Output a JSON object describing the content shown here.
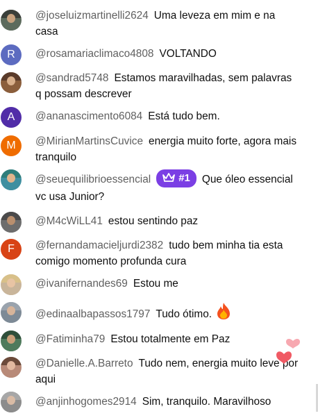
{
  "chat": {
    "messages": [
      {
        "author": "@joseluizmartinelli2624",
        "text": "Uma leveza em mim e na casa",
        "avatar": {
          "kind": "photo",
          "hair": "#3a3f3a",
          "face": "#c7a27f",
          "body": "#5d6b5d"
        }
      },
      {
        "author": "@rosamariaclimaco4808",
        "text": "VOLTANDO",
        "avatar": {
          "kind": "letter",
          "letter": "R",
          "color": "#5c6bc0"
        }
      },
      {
        "author": "@sandrad5748",
        "text": "Estamos maravilhadas, sem palavras q possam descrever",
        "avatar": {
          "kind": "photo",
          "hair": "#5a3b2a",
          "face": "#d9b08c",
          "body": "#8b5e3c"
        }
      },
      {
        "author": "@ananascimento6084",
        "text": "Está tudo bem.",
        "avatar": {
          "kind": "letter",
          "letter": "A",
          "color": "#512da8"
        }
      },
      {
        "author": "@MirianMartinsCuvice",
        "text": "energia muito forte, agora mais tranquilo",
        "avatar": {
          "kind": "letter",
          "letter": "M",
          "color": "#ef6c00"
        }
      },
      {
        "author": "@seuequilibrioessencial",
        "text": "Que óleo essencial vc usa Junior?",
        "badge": "#1",
        "badge_icon": "crown-icon",
        "avatar": {
          "kind": "photo",
          "hair": "#2e7d7a",
          "face": "#e0b48c",
          "body": "#3f8fa0"
        }
      },
      {
        "author": "@M4cWiLL41",
        "text": "estou sentindo paz",
        "avatar": {
          "kind": "photo",
          "hair": "#4a4a4a",
          "face": "#b98f6e",
          "body": "#6d6d6d"
        }
      },
      {
        "author": "@fernandamacieljurdi2382",
        "text": "tudo bem minha tia esta comigo momento profunda cura",
        "avatar": {
          "kind": "letter",
          "letter": "F",
          "color": "#d84315"
        }
      },
      {
        "author": "@ivanifernandes69",
        "text": "Estou me",
        "avatar": {
          "kind": "photo",
          "hair": "#d8c089",
          "face": "#e8c4a4",
          "body": "#c9b59a"
        }
      },
      {
        "author": "@edinaalbapassos1797",
        "text": "Tudo ótimo.",
        "emoji": "fire-icon",
        "avatar": {
          "kind": "photo",
          "hair": "#9aa3ad",
          "face": "#d6b49a",
          "body": "#7d8a96"
        }
      },
      {
        "author": "@Fatiminha79",
        "text": "Estou totalmente em Paz",
        "avatar": {
          "kind": "photo",
          "hair": "#2f4f3a",
          "face": "#c9a07a",
          "body": "#4f7a5c"
        }
      },
      {
        "author": "@Danielle.A.Barreto",
        "text": "Tudo nem, energia muito leve por aqui",
        "avatar": {
          "kind": "photo",
          "hair": "#6b4a3a",
          "face": "#e2b9a0",
          "body": "#b88a78"
        }
      },
      {
        "author": "@anjinhogomes2914",
        "text": "Sim, tranquilo. Maravilhoso",
        "avatar": {
          "kind": "photo",
          "hair": "#a7a7a7",
          "face": "#d9bba5",
          "body": "#8c8c8c"
        }
      }
    ],
    "reaction_icon": "heart-icon",
    "colors": {
      "author": "#606060",
      "text": "#0f0f0f",
      "badge": "#7b3fe4",
      "heart": "#f06a6a"
    }
  }
}
